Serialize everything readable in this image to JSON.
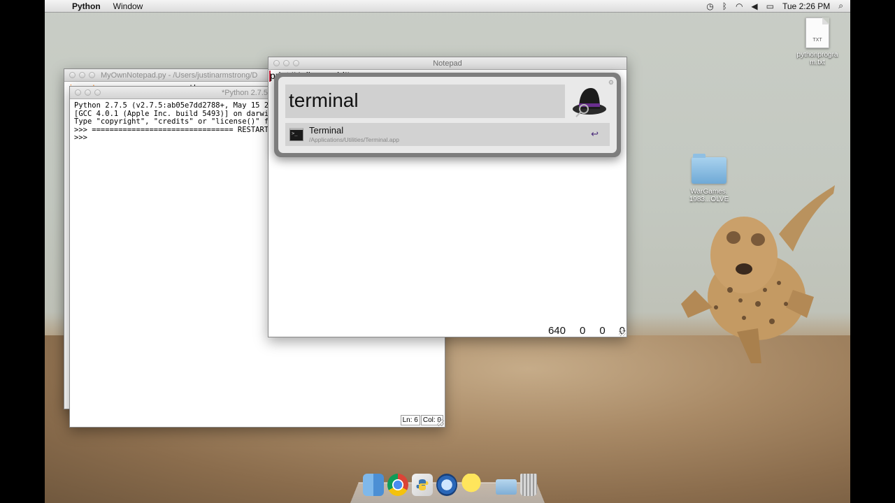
{
  "menubar": {
    "apple_glyph": "",
    "app_name": "Python",
    "menu_window": "Window",
    "clock": "Tue 2:26 PM"
  },
  "desktop": {
    "file_icon": {
      "badge": "TXT",
      "label": "pythonprogra m.txt"
    },
    "folder_icon": {
      "label": "WarGames. 1983...OLVE"
    }
  },
  "editor_window": {
    "title": "MyOwnNotepad.py - /Users/justinarmstrong/D",
    "code_keyword": "import",
    "code_rest": " pygame, sys, os, math"
  },
  "shell_window": {
    "title": "*Python 2.7.5",
    "lines": [
      "Python 2.7.5 (v2.7.5:ab05e7dd2788+, May 15 2",
      "[GCC 4.0.1 (Apple Inc. build 5493)] on darwi",
      "Type \"copyright\", \"credits\" or \"license()\" f",
      ">>> ================================ RESTART",
      ">>> "
    ],
    "status_ln": "Ln: 6",
    "status_col": "Col: 0"
  },
  "notepad_window": {
    "title": "Notepad",
    "text": "print 'Hello, world!'",
    "numbers": [
      "640",
      "0",
      "0",
      "0"
    ]
  },
  "alfred": {
    "query": "terminal",
    "result_name": "Terminal",
    "result_path": "/Applications/Utilities/Terminal.app",
    "return_glyph": "↩"
  },
  "dock": {
    "items": [
      "finder-icon",
      "chrome-icon",
      "python-launcher-icon",
      "quicktime-icon",
      "adium-icon",
      "downloads-folder-icon",
      "trash-icon"
    ]
  },
  "colors": {
    "sky": "#c6cac3",
    "ground": "#a0815f",
    "alfred_frame": "#7d7d7d",
    "cursor": "#c0203a"
  }
}
